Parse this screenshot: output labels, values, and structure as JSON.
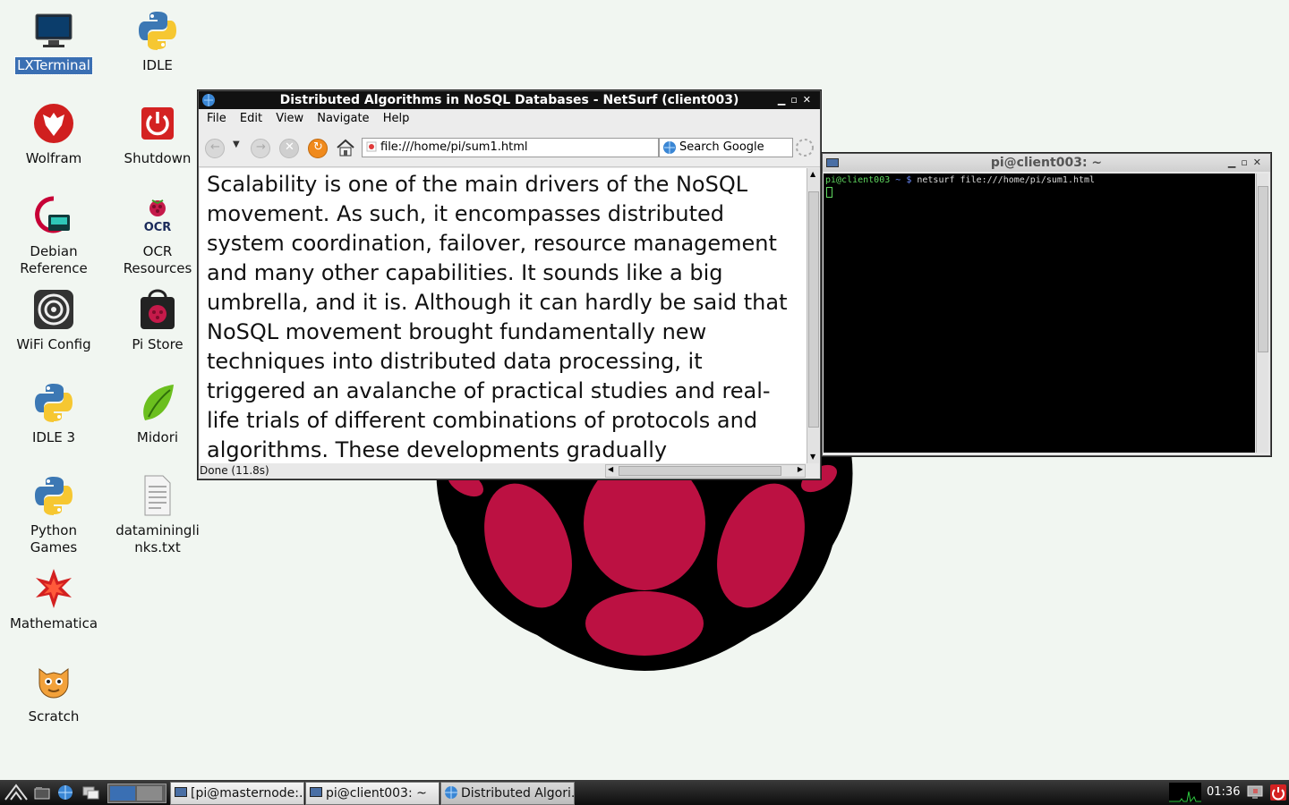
{
  "desktop_icons": [
    {
      "label": "LXTerminal",
      "icon": "terminal-icon",
      "selected": true
    },
    {
      "label": "IDLE",
      "icon": "python-icon"
    },
    {
      "label": "Wolfram",
      "icon": "wolfram-icon"
    },
    {
      "label": "Shutdown",
      "icon": "power-icon"
    },
    {
      "label": "Debian Reference",
      "icon": "debian-icon"
    },
    {
      "label": "OCR Resources",
      "icon": "ocr-icon"
    },
    {
      "label": "WiFi Config",
      "icon": "wifi-icon"
    },
    {
      "label": "Pi Store",
      "icon": "store-icon"
    },
    {
      "label": "IDLE 3",
      "icon": "python-icon"
    },
    {
      "label": "Midori",
      "icon": "midori-icon"
    },
    {
      "label": "Python Games",
      "icon": "python-icon"
    },
    {
      "label": "dataminingli nks.txt",
      "icon": "text-file-icon"
    },
    {
      "label": "Mathematica",
      "icon": "mathematica-icon"
    },
    {
      "label": "Scratch",
      "icon": "scratch-icon"
    }
  ],
  "browser": {
    "title": "Distributed Algorithms in NoSQL Databases - NetSurf (client003)",
    "menu": [
      "File",
      "Edit",
      "View",
      "Navigate",
      "Help"
    ],
    "url": "file:///home/pi/sum1.html",
    "search_placeholder": "Search Google",
    "content": "Scalability is one of the main drivers of the NoSQL movement. As such, it encompasses distributed system coordination, failover, resource management and many other capabilities. It sounds like a big umbrella, and it is. Although it can hardly be said that NoSQL movement brought fundamentally new techniques into distributed data processing, it triggered an avalanche of practical studies and real-life trials of different combinations of protocols and algorithms. These developments gradually",
    "status": "Done (11.8s)"
  },
  "terminal": {
    "title": "pi@client003: ~",
    "prompt_user": "pi@client003",
    "prompt_path": "~ $",
    "command": "netsurf file:///home/pi/sum1.html"
  },
  "taskbar": {
    "tasks": [
      "[pi@masternode:...",
      "pi@client003: ~",
      "Distributed Algori..."
    ],
    "clock": "01:36"
  },
  "colors": {
    "raspberry": "#bc1142",
    "desktop_bg": "#f1f6f1",
    "titlebar_active": "#111111"
  }
}
